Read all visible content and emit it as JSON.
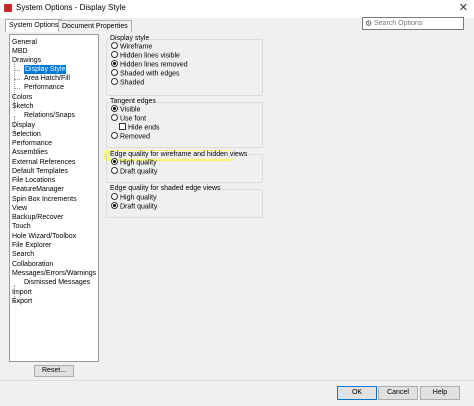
{
  "window": {
    "title": "System Options - Display Style"
  },
  "tabs": [
    {
      "label": "System Options"
    },
    {
      "label": "Document Properties"
    }
  ],
  "search": {
    "placeholder": "Search Options"
  },
  "tree": {
    "items": [
      "General",
      "MBD",
      "Drawings",
      "Display Style",
      "Area Hatch/Fill",
      "Performance",
      "Colors",
      "Sketch",
      "Relations/Snaps",
      "Display",
      "Selection",
      "Performance",
      "Assemblies",
      "External References",
      "Default Templates",
      "File Locations",
      "FeatureManager",
      "Spin Box Increments",
      "View",
      "Backup/Recover",
      "Touch",
      "Hole Wizard/Toolbox",
      "File Explorer",
      "Search",
      "Collaboration",
      "Messages/Errors/Warnings",
      "Dismissed Messages",
      "Import",
      "Export"
    ]
  },
  "reset_label": "Reset...",
  "display_style": {
    "label": "Display style",
    "options": [
      "Wireframe",
      "Hidden lines visible",
      "Hidden lines removed",
      "Shaded with edges",
      "Shaded"
    ],
    "selected": 2
  },
  "tangent_edges": {
    "label": "Tangent edges",
    "options": [
      "Visible",
      "Use font",
      "Hide ends",
      "Removed"
    ],
    "selected": 0
  },
  "edge_quality_wireframe": {
    "label": "Edge quality for wireframe and hidden views",
    "options": [
      "High quality",
      "Draft quality"
    ],
    "selected": 0
  },
  "edge_quality_shaded": {
    "label": "Edge quality for shaded edge views",
    "options": [
      "High quality",
      "Draft quality"
    ],
    "selected": 1
  },
  "footer": {
    "ok": "OK",
    "cancel": "Cancel",
    "help": "Help"
  },
  "colors": {
    "selection": "#0078d7",
    "highlight": "#ffff00"
  },
  "icons": {
    "app": "solidworks-icon",
    "close": "close-icon",
    "search": "search-icon"
  }
}
